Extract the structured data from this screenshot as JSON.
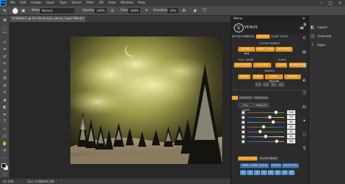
{
  "app": {
    "logo": "Ps"
  },
  "menubar": {
    "items": [
      "File",
      "Edit",
      "Image",
      "Layer",
      "Type",
      "Select",
      "Filter",
      "3D",
      "View",
      "Window",
      "Help"
    ]
  },
  "options": {
    "mode_label": "Mode:",
    "mode_value": "Normal",
    "opacity_label": "Opacity:",
    "opacity_value": "100%",
    "flow_label": "Flow:",
    "flow_value": "100%",
    "smoothing_label": "Smoothing:",
    "smoothing_value": "10%",
    "brush_size": "40"
  },
  "document": {
    "tab_title": "Untitled-1 @ 33.3% (sunny_venus, Layer Mask/8) *"
  },
  "status": {
    "zoom": "33.33%",
    "doc": "Doc: 9.89M/26.2M"
  },
  "panel": {
    "header": "Venus",
    "logo": "VENUS",
    "nav_tabs": [
      "RETOUCHING",
      "DOPA",
      "SPECIFIC",
      "FLAIR",
      "TOOLS"
    ],
    "color_swirls_title": "COLOR SWIRLS",
    "swirl_buttons": [
      "GREEN + RED",
      "WARM + COLD",
      "INFRARED"
    ],
    "full_layer_title": "FULL LAYER",
    "fixed_title": "FIXED",
    "full_buttons": [
      "COLD WHITE",
      "COLD RED",
      "COLOR",
      "DOWNLIGHT"
    ],
    "single_title": "SINGLE",
    "single_buttons_row1": [
      "JOYFUL",
      "SUNNY",
      "SHINY YELLOW",
      "SEPIATA"
    ],
    "single_buttons_row2": [
      "FITL",
      "O/A",
      "R/L",
      "Q/T"
    ],
    "sub_tabs": [
      "HSL",
      "GRADIENT",
      "CYAN/AQUA"
    ],
    "sub_buttons": [
      "FULL LAYER",
      "FINALIZE"
    ],
    "slider_values": [
      "100",
      "75",
      "64",
      "40",
      "20",
      "50",
      "500"
    ],
    "bottom_tabs": [
      "SPECIFY PANEL",
      "COLOR RANGE"
    ],
    "action_buttons": [
      "CREA. LAYER (COLD)",
      "UPDATE",
      "DELETE ALL"
    ],
    "small_buttons": [
      "1",
      "2",
      "3",
      "4",
      "5",
      "6",
      "7",
      "8"
    ]
  },
  "dock": {
    "items": [
      "Layers",
      "Channels",
      "Paths"
    ]
  },
  "colors": {
    "accent": "#e4961f",
    "ps_blue": "#31a8ff",
    "panel_bg": "#2b2b2b"
  }
}
